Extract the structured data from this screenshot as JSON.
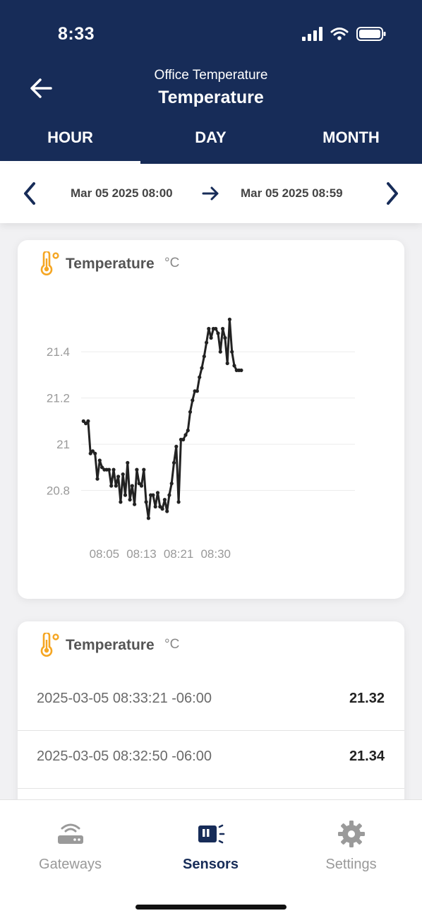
{
  "status": {
    "time": "8:33"
  },
  "header": {
    "subtitle": "Office Temperature",
    "title": "Temperature",
    "tabs": [
      {
        "label": "HOUR"
      },
      {
        "label": "DAY"
      },
      {
        "label": "MONTH"
      }
    ],
    "active_tab": "HOUR"
  },
  "range": {
    "start": "Mar 05 2025 08:00",
    "end": "Mar 05 2025 08:59"
  },
  "chart_card": {
    "title": "Temperature",
    "unit": "°C"
  },
  "chart_data": {
    "type": "line",
    "title": "Temperature",
    "ylabel": "°C",
    "xlim": [
      0,
      59
    ],
    "ylim": [
      20.6,
      21.7
    ],
    "yticks": [
      20.8,
      21,
      21.2,
      21.4
    ],
    "ytick_labels": [
      "20.8",
      "21",
      "21.2",
      "21.4"
    ],
    "xticks": [
      5,
      13,
      21,
      29
    ],
    "xtick_labels": [
      "08:05",
      "08:13",
      "08:21",
      "08:30"
    ],
    "grid": true,
    "line_color": "#222222",
    "series": [
      {
        "x": [
          0.5,
          1.0,
          1.5,
          2.0,
          2.5,
          3.0,
          3.5,
          4.0,
          4.5,
          5.0,
          5.5,
          6.0,
          6.5,
          7.0,
          7.5,
          8.0,
          8.5,
          9.0,
          9.5,
          10.0,
          10.5,
          11.0,
          11.5,
          12.0,
          12.5,
          13.0,
          13.5,
          14.0,
          14.5,
          15.0,
          15.5,
          16.0,
          16.5,
          17.0,
          17.5,
          18.0,
          18.5,
          19.0,
          19.5,
          20.0,
          20.5,
          21.0,
          21.5,
          22.0,
          22.5,
          23.0,
          23.5,
          24.0,
          24.5,
          25.0,
          25.5,
          26.0,
          26.5,
          27.0,
          27.5,
          28.0,
          28.5,
          29.0,
          29.5,
          30.0,
          30.5,
          31.0,
          31.5,
          32.0,
          32.5,
          33.0,
          33.5,
          34.0,
          34.5
        ],
        "y": [
          21.1,
          21.09,
          21.1,
          20.96,
          20.97,
          20.96,
          20.85,
          20.93,
          20.9,
          20.89,
          20.89,
          20.89,
          20.82,
          20.89,
          20.82,
          20.86,
          20.75,
          20.87,
          20.78,
          20.92,
          20.76,
          20.82,
          20.74,
          20.89,
          20.83,
          20.82,
          20.89,
          20.75,
          20.68,
          20.78,
          20.78,
          20.73,
          20.79,
          20.73,
          20.72,
          20.76,
          20.71,
          20.78,
          20.83,
          20.92,
          20.99,
          20.75,
          21.02,
          21.02,
          21.04,
          21.06,
          21.14,
          21.19,
          21.23,
          21.23,
          21.29,
          21.33,
          21.38,
          21.44,
          21.5,
          21.46,
          21.5,
          21.5,
          21.48,
          21.4,
          21.5,
          21.46,
          21.35,
          21.54,
          21.4,
          21.34,
          21.32,
          21.32,
          21.32
        ]
      }
    ]
  },
  "list_card": {
    "title": "Temperature",
    "unit": "°C",
    "rows": [
      {
        "timestamp": "2025-03-05 08:33:21 -06:00",
        "value": "21.32"
      },
      {
        "timestamp": "2025-03-05 08:32:50 -06:00",
        "value": "21.34"
      }
    ]
  },
  "bottom_nav": {
    "items": [
      {
        "label": "Gateways"
      },
      {
        "label": "Sensors"
      },
      {
        "label": "Settings"
      }
    ],
    "active": "Sensors"
  },
  "colors": {
    "header": "#172c58",
    "accent": "#f5a623",
    "active_nav": "#172c58"
  }
}
